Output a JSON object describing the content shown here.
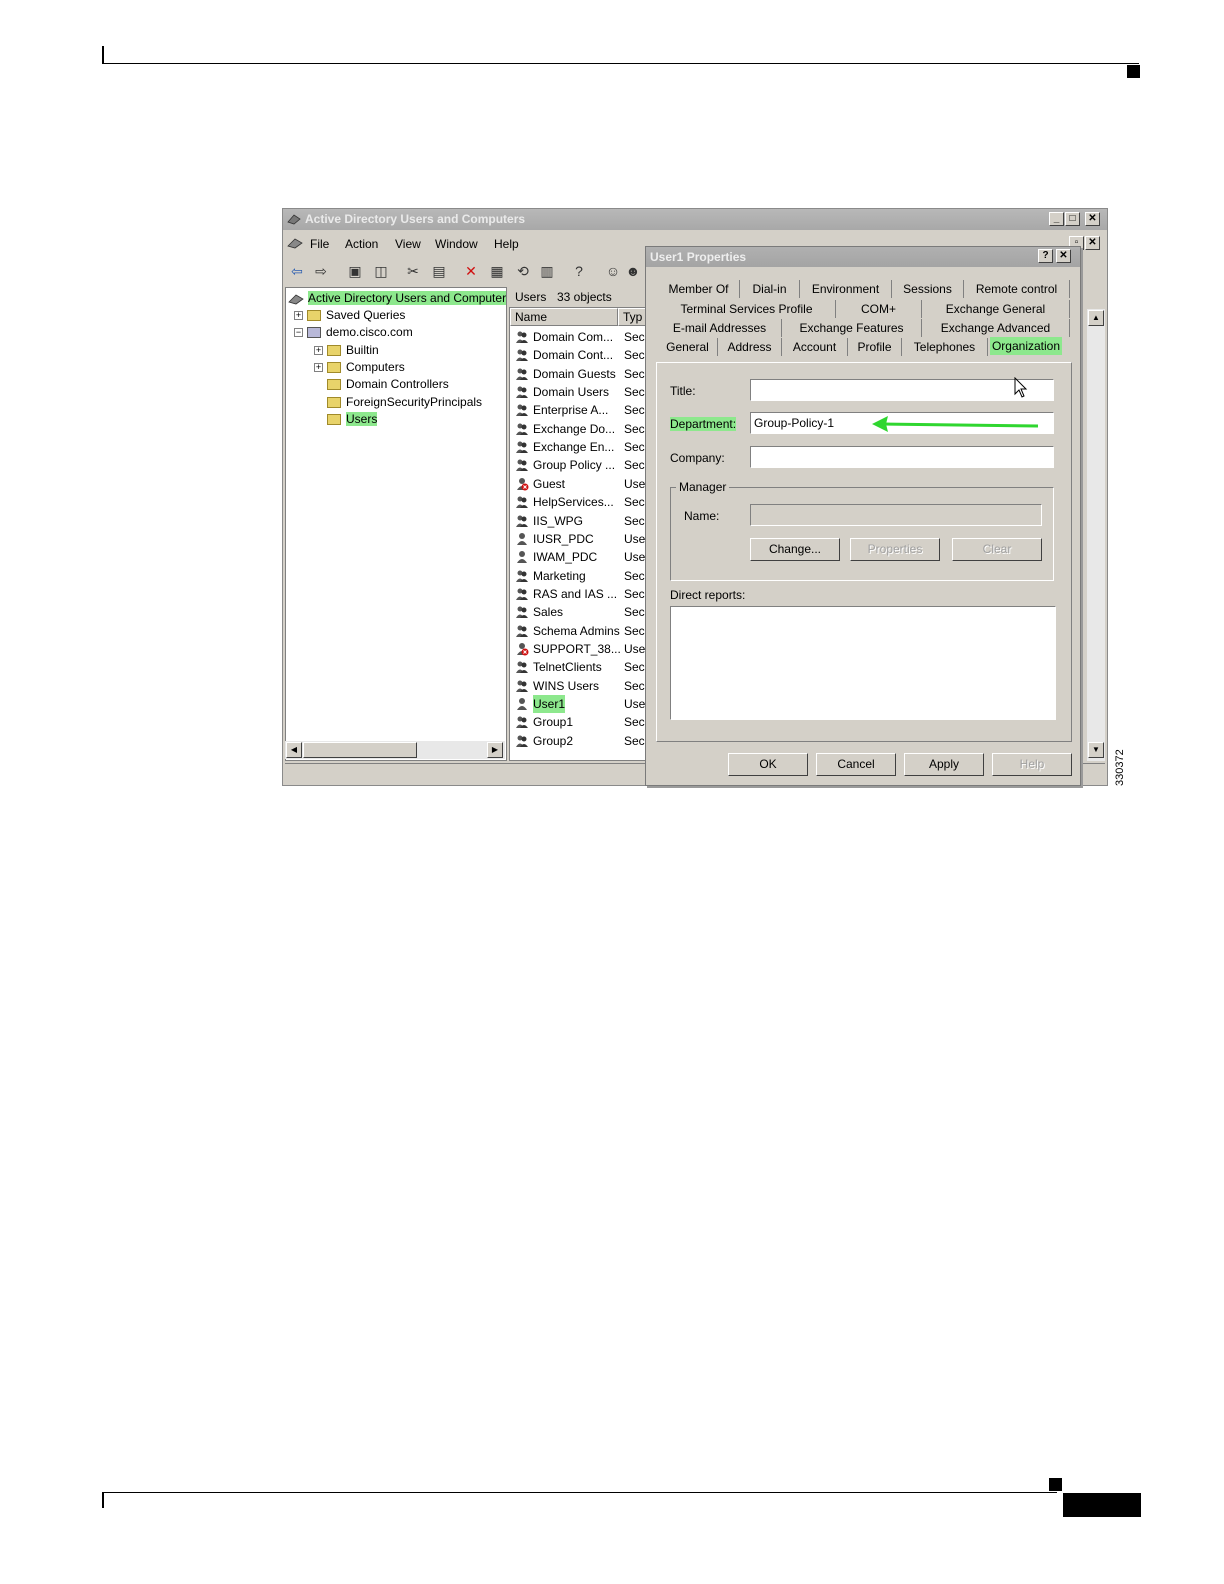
{
  "main_window": {
    "title": "Active Directory Users and Computers",
    "menu": [
      "File",
      "Action",
      "View",
      "Window",
      "Help"
    ],
    "tree": {
      "root": "Active Directory Users and Computer",
      "items": [
        "Saved Queries",
        "demo.cisco.com",
        "Builtin",
        "Computers",
        "Domain Controllers",
        "ForeignSecurityPrincipals",
        "Users"
      ]
    },
    "list": {
      "header_label": "Users",
      "header_count": "33 objects",
      "columns": [
        "Name",
        "Typ"
      ],
      "rows": [
        {
          "name": "Domain Com...",
          "type": "Sec"
        },
        {
          "name": "Domain Cont...",
          "type": "Sec"
        },
        {
          "name": "Domain Guests",
          "type": "Sec"
        },
        {
          "name": "Domain Users",
          "type": "Sec"
        },
        {
          "name": "Enterprise A...",
          "type": "Sec"
        },
        {
          "name": "Exchange Do...",
          "type": "Sec"
        },
        {
          "name": "Exchange En...",
          "type": "Sec"
        },
        {
          "name": "Group Policy ...",
          "type": "Sec"
        },
        {
          "name": "Guest",
          "type": "Use"
        },
        {
          "name": "HelpServices...",
          "type": "Sec"
        },
        {
          "name": "IIS_WPG",
          "type": "Sec"
        },
        {
          "name": "IUSR_PDC",
          "type": "Use"
        },
        {
          "name": "IWAM_PDC",
          "type": "Use"
        },
        {
          "name": "Marketing",
          "type": "Sec"
        },
        {
          "name": "RAS and IAS ...",
          "type": "Sec"
        },
        {
          "name": "Sales",
          "type": "Sec"
        },
        {
          "name": "Schema Admins",
          "type": "Sec"
        },
        {
          "name": "SUPPORT_38...",
          "type": "Use"
        },
        {
          "name": "TelnetClients",
          "type": "Sec"
        },
        {
          "name": "WINS Users",
          "type": "Sec"
        },
        {
          "name": "User1",
          "type": "Use"
        },
        {
          "name": "Group1",
          "type": "Sec"
        },
        {
          "name": "Group2",
          "type": "Sec"
        }
      ]
    }
  },
  "dialog": {
    "title": "User1 Properties",
    "help_btn": "?",
    "tabs_row1": [
      "Member Of",
      "Dial-in",
      "Environment",
      "Sessions",
      "Remote control"
    ],
    "tabs_row2": [
      "Terminal Services Profile",
      "COM+",
      "Exchange General"
    ],
    "tabs_row3": [
      "E-mail Addresses",
      "Exchange Features",
      "Exchange Advanced"
    ],
    "tabs_row4": [
      "General",
      "Address",
      "Account",
      "Profile",
      "Telephones",
      "Organization"
    ],
    "fields": {
      "title_label": "Title:",
      "title_value": "",
      "department_label": "Department:",
      "department_value": "Group-Policy-1",
      "company_label": "Company:",
      "company_value": ""
    },
    "manager": {
      "group_label": "Manager",
      "name_label": "Name:",
      "name_value": "",
      "change_btn": "Change...",
      "properties_btn": "Properties",
      "clear_btn": "Clear"
    },
    "direct_reports_label": "Direct reports:",
    "buttons": {
      "ok": "OK",
      "cancel": "Cancel",
      "apply": "Apply",
      "help": "Help"
    }
  },
  "figure_id": "330372",
  "colors": {
    "highlight": "#8de88d",
    "arrow": "#2fd62f",
    "window_bg": "#d4d0c8"
  }
}
